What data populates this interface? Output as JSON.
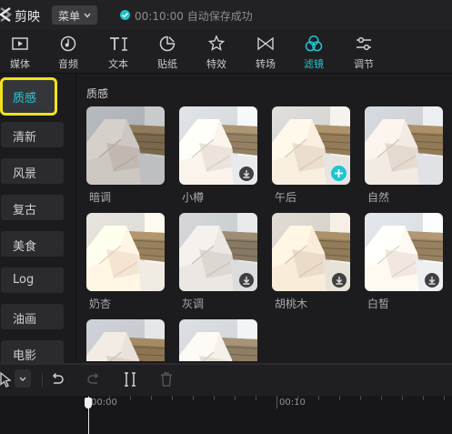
{
  "app": {
    "name": "剪映"
  },
  "topbar": {
    "menu_label": "菜单",
    "save_status": "00:10:00 自动保存成功"
  },
  "toolbar": {
    "tools": [
      {
        "label": "媒体",
        "icon": "media-icon"
      },
      {
        "label": "音频",
        "icon": "audio-icon"
      },
      {
        "label": "文本",
        "icon": "text-icon"
      },
      {
        "label": "贴纸",
        "icon": "sticker-icon"
      },
      {
        "label": "特效",
        "icon": "effects-icon"
      },
      {
        "label": "转场",
        "icon": "transition-icon"
      },
      {
        "label": "滤镜",
        "icon": "filter-icon",
        "active": true
      },
      {
        "label": "调节",
        "icon": "adjust-icon"
      }
    ]
  },
  "sidebar": {
    "categories": [
      "质感",
      "清新",
      "风景",
      "复古",
      "美食",
      "Log",
      "油画",
      "电影"
    ],
    "active": "质感"
  },
  "filters": {
    "section_title": "质感",
    "items": [
      {
        "name": "暗调",
        "action": "none"
      },
      {
        "name": "小樽",
        "action": "download"
      },
      {
        "name": "午后",
        "action": "add"
      },
      {
        "name": "自然",
        "action": "none"
      },
      {
        "name": "奶杏",
        "action": "none"
      },
      {
        "name": "灰调",
        "action": "download"
      },
      {
        "name": "胡桃木",
        "action": "download"
      },
      {
        "name": "白皙",
        "action": "download"
      },
      {
        "name": "",
        "action": "none"
      },
      {
        "name": "",
        "action": "none"
      }
    ]
  },
  "timeline": {
    "time_labels": [
      "00:00",
      "00:10"
    ]
  },
  "colors": {
    "accent": "#23c4d1",
    "highlight_box": "#f2e11a"
  }
}
